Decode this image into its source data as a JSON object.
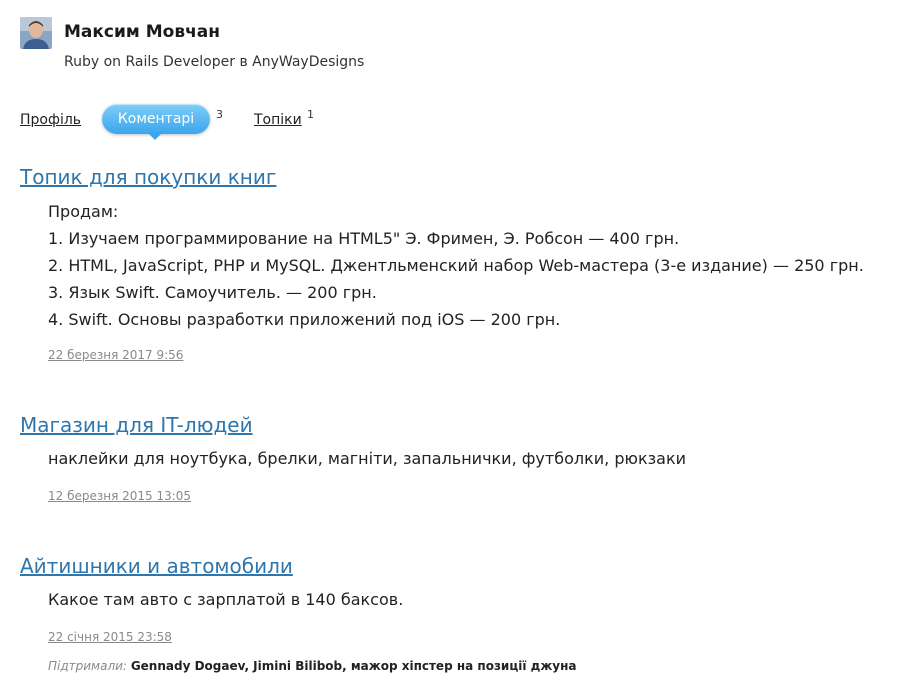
{
  "profile": {
    "name": "Максим Мовчан",
    "role": "Ruby on Rails Developer в AnyWayDesigns"
  },
  "tabs": [
    {
      "label": "Профіль",
      "count": "",
      "active": false
    },
    {
      "label": "Коментарі",
      "count": "3",
      "active": true
    },
    {
      "label": "Топіки",
      "count": "1",
      "active": false
    }
  ],
  "comments": [
    {
      "title": "Топик для покупки книг",
      "lines": [
        "Продам:",
        "1. Изучаем программирование на HTML5\" Э. Фримен, Э. Робсон — 400 грн.",
        "2. HTML, JavaScript, PHP и MySQL. Джентльменский набор Web-мастера (3-е издание) — 250 грн.",
        "3. Язык Swift. Самоучитель. — 200 грн.",
        "4. Swift. Основы разработки приложений под iOS — 200 грн."
      ],
      "date": "22 березня 2017 9:56"
    },
    {
      "title": "Магазин для IT-людей",
      "lines": [
        "наклейки для ноутбука, брелки, магніти, запальнички, футболки, рюкзаки"
      ],
      "date": "12 березня 2015 13:05"
    },
    {
      "title": "Айтишники и автомобили",
      "lines": [
        "Какое там авто с зарплатой в 140 баксов."
      ],
      "date": "22 січня 2015 23:58",
      "supported_label": "Підтримали:",
      "supported_by": "Gennady Dogaev, Jimini Bilibob, мажор хіпстер на позиції джуна"
    }
  ],
  "colors": {
    "link": "#2f76ad",
    "tab_active_top": "#7dcdf8",
    "tab_active_bottom": "#3ba5ec",
    "muted": "#8a8a8a"
  }
}
